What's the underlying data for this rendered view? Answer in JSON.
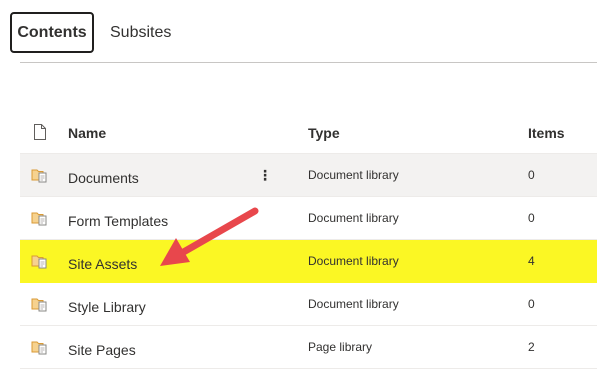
{
  "tabs": [
    {
      "label": "Contents",
      "active": true
    },
    {
      "label": "Subsites",
      "active": false
    }
  ],
  "columns": {
    "name": "Name",
    "type": "Type",
    "items": "Items"
  },
  "rows": [
    {
      "name": "Documents",
      "type": "Document library",
      "items": "0",
      "state": "hover",
      "more_icon": "⋮"
    },
    {
      "name": "Form Templates",
      "type": "Document library",
      "items": "0",
      "state": "normal"
    },
    {
      "name": "Site Assets",
      "type": "Document library",
      "items": "4",
      "state": "highlighted"
    },
    {
      "name": "Style Library",
      "type": "Document library",
      "items": "0",
      "state": "normal"
    },
    {
      "name": "Site Pages",
      "type": "Page library",
      "items": "2",
      "state": "normal"
    }
  ],
  "icons": {
    "header": "file-icon",
    "row": "library-icon",
    "annotation": "red-arrow"
  },
  "colors": {
    "highlight": "#fbf724",
    "arrow": "#e8474c",
    "library_icon": "#e0a84a",
    "hover": "#f3f2f1"
  }
}
